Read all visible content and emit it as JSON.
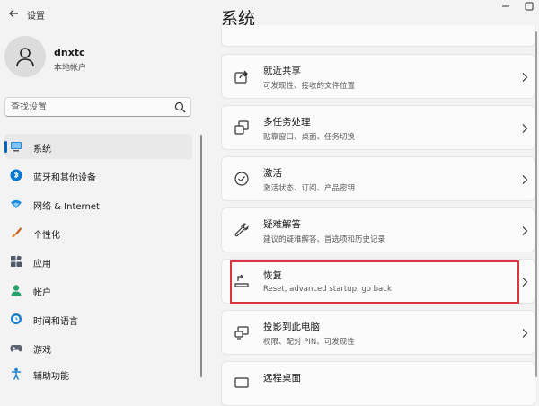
{
  "window": {
    "title": "设置"
  },
  "profile": {
    "name": "dnxtc",
    "account_type": "本地帐户"
  },
  "search": {
    "placeholder": "查找设置"
  },
  "nav": {
    "items": [
      {
        "label": "系统",
        "icon": "monitor-icon",
        "active": true
      },
      {
        "label": "蓝牙和其他设备",
        "icon": "bluetooth-icon"
      },
      {
        "label": "网络 & Internet",
        "icon": "wifi-icon"
      },
      {
        "label": "个性化",
        "icon": "brush-icon"
      },
      {
        "label": "应用",
        "icon": "apps-icon"
      },
      {
        "label": "帐户",
        "icon": "person-icon"
      },
      {
        "label": "时间和语言",
        "icon": "globe-clock-icon"
      },
      {
        "label": "游戏",
        "icon": "gamepad-icon"
      },
      {
        "label": "辅助功能",
        "icon": "accessibility-icon"
      }
    ]
  },
  "main": {
    "title": "系统",
    "items": [
      {
        "title": "就近共享",
        "subtitle": "可发现性、接收的文件位置",
        "icon": "share-icon"
      },
      {
        "title": "多任务处理",
        "subtitle": "贴靠窗口、桌面、任务切换",
        "icon": "multitask-icon"
      },
      {
        "title": "激活",
        "subtitle": "激活状态、订阅、产品密钥",
        "icon": "check-circle-icon"
      },
      {
        "title": "疑难解答",
        "subtitle": "建议的疑难解答、首选项和历史记录",
        "icon": "wrench-icon"
      },
      {
        "title": "恢复",
        "subtitle": "Reset, advanced startup, go back",
        "icon": "recovery-icon",
        "highlighted": true
      },
      {
        "title": "投影到此电脑",
        "subtitle": "权限、配对 PIN、可发现性",
        "icon": "project-icon"
      },
      {
        "title": "远程桌面",
        "subtitle": "",
        "icon": "remote-desktop-icon"
      }
    ]
  },
  "colors": {
    "accent": "#0067c0",
    "highlight_border": "#d9363e",
    "background": "#f3f3f3",
    "card": "#fbfbfb"
  }
}
